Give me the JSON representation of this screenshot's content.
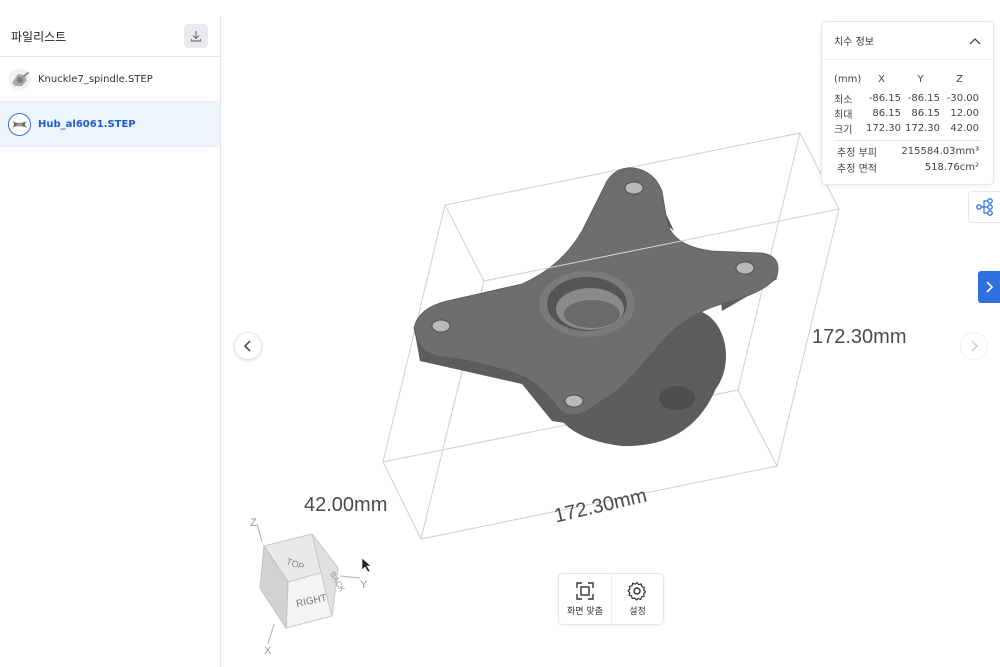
{
  "sidebar": {
    "title": "파일리스트",
    "files": [
      {
        "name": "Knuckle7_spindle.STEP",
        "active": false
      },
      {
        "name": "Hub_al6061.STEP",
        "active": true
      }
    ]
  },
  "viewer": {
    "dimensions": {
      "height_label": "172.30mm",
      "width_label": "172.30mm",
      "depth_label": "42.00mm"
    },
    "cube": {
      "top": "TOP",
      "right": "RIGHT",
      "back": "BACK",
      "axis_x": "X",
      "axis_y": "Y",
      "axis_z": "Z"
    }
  },
  "dim_panel": {
    "title": "치수 정보",
    "header": {
      "unit": "(mm)",
      "x": "X",
      "y": "Y",
      "z": "Z"
    },
    "rows": [
      {
        "label": "최소",
        "x": "-86.15",
        "y": "-86.15",
        "z": "-30.00"
      },
      {
        "label": "최대",
        "x": "86.15",
        "y": "86.15",
        "z": "12.00"
      },
      {
        "label": "크기",
        "x": "172.30",
        "y": "172.30",
        "z": "42.00"
      }
    ],
    "volume_label": "추정 부피",
    "volume_value": "215584.03mm³",
    "area_label": "추정 면적",
    "area_value": "518.76cm²"
  },
  "toolbar": {
    "fit_label": "화면 맞춤",
    "settings_label": "설정"
  },
  "colors": {
    "accent": "#2f6fe0",
    "active_text": "#1d5fc7",
    "active_bg": "#eef4fc",
    "part": "#6e6e6e"
  }
}
